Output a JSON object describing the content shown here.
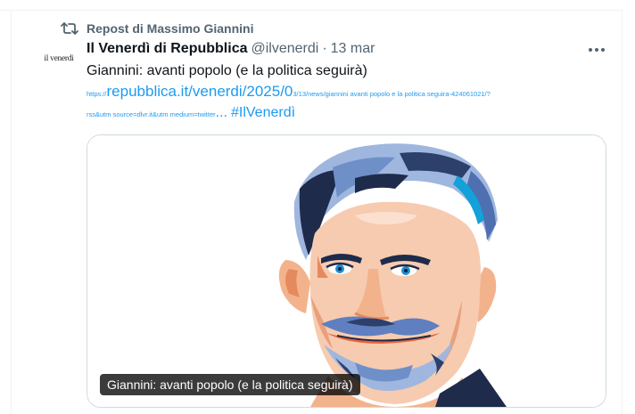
{
  "repost": {
    "icon": "repost-icon",
    "label": "Repost di Massimo Giannini"
  },
  "tweet": {
    "avatar_text": "il venerdì",
    "author_name": "Il Venerdì di Repubblica",
    "author_handle": "@ilvenerdi",
    "separator": "·",
    "timestamp": "13 mar",
    "text": "Giannini: avanti popolo (e la politica seguirà)",
    "link": {
      "prefix": "https://",
      "domain_path": "repubblica.it/venerdi/2025/0",
      "rest_line1": "3/13/news/giannini avanti popolo e la politica seguira-424061021/?",
      "rest_line2": "rss&utm source=dlvr.it&utm medium=twitter",
      "ellipsis": "..."
    },
    "hashtag": "#IlVenerdì",
    "media": {
      "caption": "Giannini: avanti popolo (e la politica seguirà)"
    }
  },
  "colors": {
    "link": "#1d9bf0",
    "secondary_text": "#536471",
    "primary_text": "#0f1419",
    "border": "#cfd9de"
  }
}
